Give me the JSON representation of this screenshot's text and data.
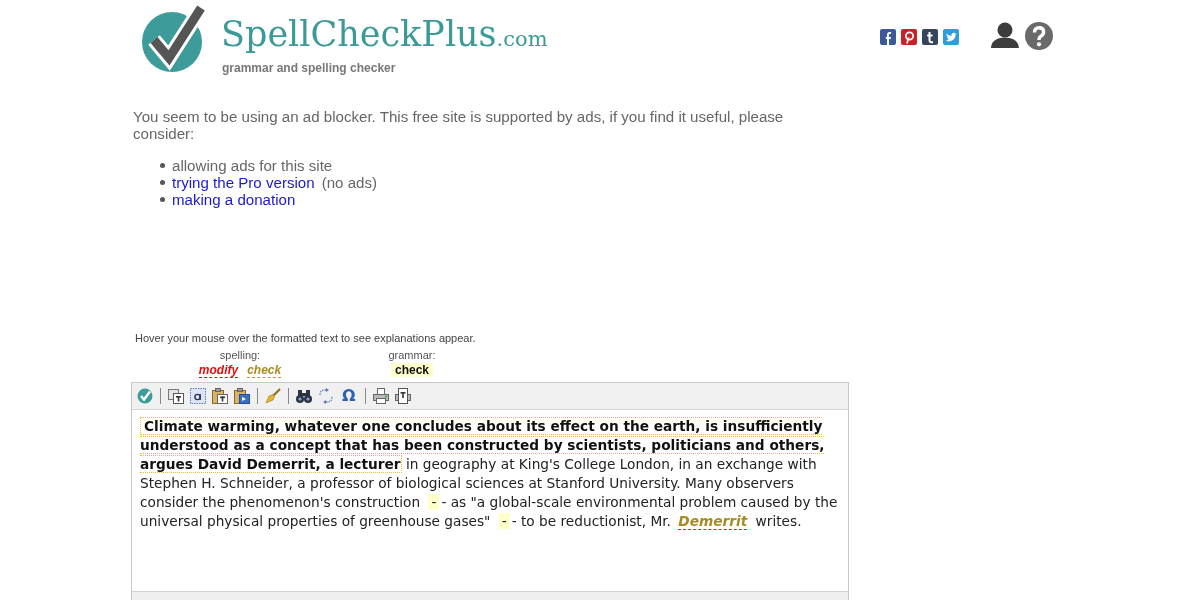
{
  "header": {
    "logo_name": "SpellCheckPlus",
    "logo_suffix": ".com",
    "tagline": "grammar and spelling checker"
  },
  "notice": {
    "message": "You seem to be using an ad blocker. This free site is supported by ads, if you find it useful, please consider:",
    "options": [
      {
        "text": "allowing ads for this site"
      },
      {
        "link": "trying the Pro version",
        "note": "(no ads)"
      },
      {
        "link": "making a donation"
      }
    ]
  },
  "hint": "Hover your mouse over the formatted text to see explanations appear.",
  "legend": [
    {
      "label": "spelling:",
      "items": [
        {
          "text": "modify",
          "kind": "error"
        },
        {
          "text": "check",
          "kind": "doubt"
        }
      ]
    },
    {
      "label": "grammar:",
      "items": [
        {
          "text": "check",
          "kind": "grammar"
        }
      ]
    }
  ],
  "toolbar": {
    "symbol_button": "Ω"
  },
  "editor": {
    "segments": [
      {
        "kind": "sentence",
        "text": "Climate warming, whatever one concludes about its effect on the earth, is insufficiently understood as a concept that has been constructed by scientists, politicians and others, argues David Demerrit, a lecturer"
      },
      {
        "kind": "plain",
        "text": " in geography at King's College London, in an exchange with Stephen H. Schneider, a professor of biological sciences at Stanford University. Many observers consider the phenomenon's construction "
      },
      {
        "kind": "mark",
        "text": "-"
      },
      {
        "kind": "plain",
        "text": "- as \"a global-scale environmental problem caused by the universal physical properties of greenhouse gases\" "
      },
      {
        "kind": "mark",
        "text": "-"
      },
      {
        "kind": "plain",
        "text": "- to be reductionist, Mr. "
      },
      {
        "kind": "doubt",
        "text": "Demerrit"
      },
      {
        "kind": "plain",
        "text": " writes."
      }
    ]
  }
}
